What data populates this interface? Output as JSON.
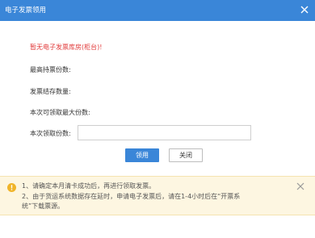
{
  "dialog": {
    "title": "电子发票领用",
    "warning": "暂无电子发票库房(柜台)!",
    "fields": {
      "max_label": "最高持票份数:",
      "stock_label": "发票结存数量:",
      "max_claim_label": "本次可领取最大份数:",
      "claim_label": "本次领取份数:"
    },
    "claim_input": {
      "value": "",
      "placeholder": ""
    },
    "buttons": {
      "confirm": "领用",
      "close": "关闭"
    }
  },
  "notice": {
    "line1": "1、请确定本月清卡成功后，再进行领取发票。",
    "line2": "2、由于货运系统数据存在延时，申请电子发票后，请在1-4小时后在“开票系",
    "line3": "统”下载票源。"
  },
  "colors": {
    "header": "#3a86d8",
    "primary": "#3a86d8",
    "warning": "#e23c3c",
    "notice_bg": "#fdf6e1",
    "notice_icon": "#f0b429"
  },
  "icons": {
    "close": "close-icon",
    "warning": "warning-icon",
    "dismiss": "dismiss-icon"
  }
}
